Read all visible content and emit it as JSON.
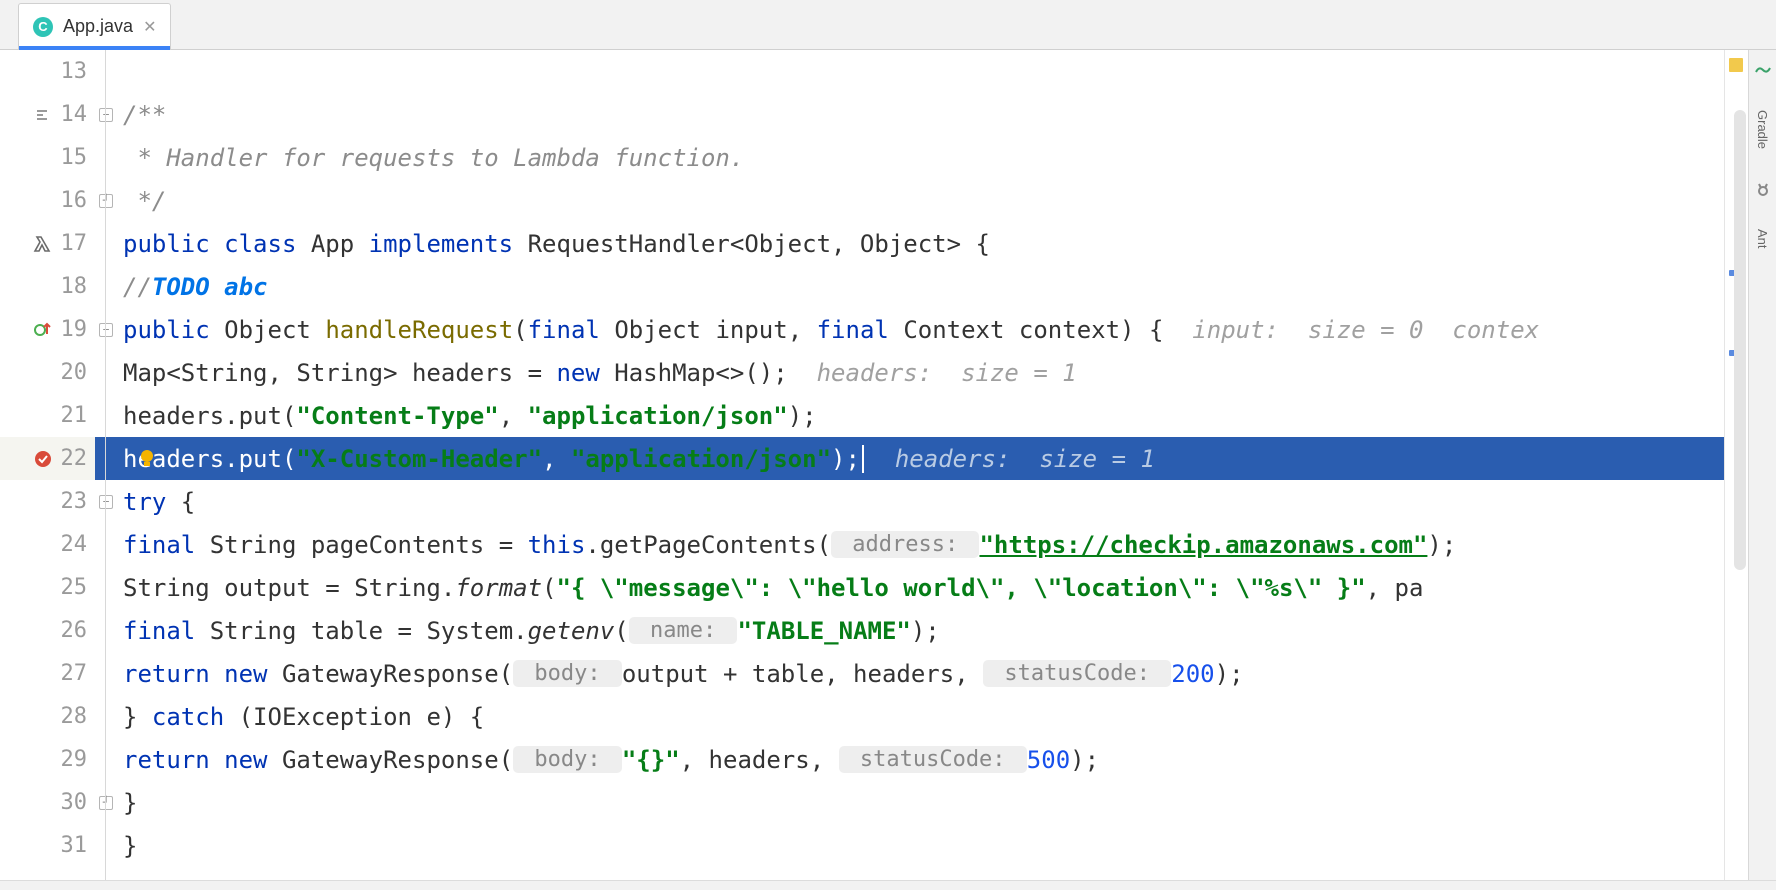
{
  "tab": {
    "label": "App.java",
    "icon_letter": "C"
  },
  "toolcol": {
    "item1": "Gradle",
    "item2": "Ant"
  },
  "lines": [
    {
      "n": "13"
    },
    {
      "n": "14"
    },
    {
      "n": "15"
    },
    {
      "n": "16"
    },
    {
      "n": "17"
    },
    {
      "n": "18"
    },
    {
      "n": "19"
    },
    {
      "n": "20"
    },
    {
      "n": "21"
    },
    {
      "n": "22"
    },
    {
      "n": "23"
    },
    {
      "n": "24"
    },
    {
      "n": "25"
    },
    {
      "n": "26"
    },
    {
      "n": "27"
    },
    {
      "n": "28"
    },
    {
      "n": "29"
    },
    {
      "n": "30"
    },
    {
      "n": "31"
    }
  ],
  "c14": {
    "a": "/**"
  },
  "c15": {
    "a": " * Handler for requests to Lambda function."
  },
  "c16": {
    "a": " */"
  },
  "c17": {
    "kw1": "public class ",
    "id": "App ",
    "kw2": "implements ",
    "rest": "RequestHandler<Object, Object> {"
  },
  "c18": {
    "pre": "//",
    "todo": "TODO abc"
  },
  "c19": {
    "kw1": "public ",
    "t1": "Object ",
    "fn": "handleRequest",
    "p": "(",
    "kw2": "final ",
    "t2": "Object input, ",
    "kw3": "final ",
    "t3": "Context context) {",
    "h1": "  input:",
    "h2": "  size = 0",
    "h3": "  contex"
  },
  "c20": {
    "a": "Map<String, String> headers = ",
    "kw": "new ",
    "b": "HashMap<>();",
    "h1": "  headers:",
    "h2": "  size = 1"
  },
  "c21": {
    "a": "headers.put(",
    "s1": "\"Content-Type\"",
    "b": ", ",
    "s2": "\"application/json\"",
    "c": ");"
  },
  "c22": {
    "a": "headers.put(",
    "s1": "\"X-Custom-Header\"",
    "b": ", ",
    "s2": "\"application/json\"",
    "c": ");",
    "h1": "  headers:",
    "h2": "  size = 1"
  },
  "c23": {
    "kw": "try ",
    "a": "{"
  },
  "c24": {
    "kw": "final ",
    "a": "String pageContents = ",
    "kw2": "this",
    "b": ".getPageContents(",
    "hint": " address: ",
    "url": "\"https://checkip.amazonaws.com\"",
    "c": ");"
  },
  "c25": {
    "a": "String output = String.",
    "it": "format",
    "b": "(",
    "s": "\"{ \\\"message\\\": \\\"hello world\\\", \\\"location\\\": \\\"%s\\\" }\"",
    "c": ", pa"
  },
  "c26": {
    "kw": "final ",
    "a": "String table = System.",
    "it": "getenv",
    "b": "(",
    "hint": " name: ",
    "s": "\"TABLE_NAME\"",
    "c": ");"
  },
  "c27": {
    "kw": "return new ",
    "a": "GatewayResponse(",
    "h1": " body: ",
    "b": "output + table, headers, ",
    "h2": " statusCode: ",
    "n": "200",
    "c": ");"
  },
  "c28": {
    "a": "} ",
    "kw": "catch ",
    "b": "(IOException e) {"
  },
  "c29": {
    "kw": "return new ",
    "a": "GatewayResponse(",
    "h1": " body: ",
    "s": "\"{}\"",
    "b": ", headers, ",
    "h2": " statusCode: ",
    "n": "500",
    "c": ");"
  },
  "c30": {
    "a": "}"
  },
  "c31": {
    "a": "}"
  }
}
